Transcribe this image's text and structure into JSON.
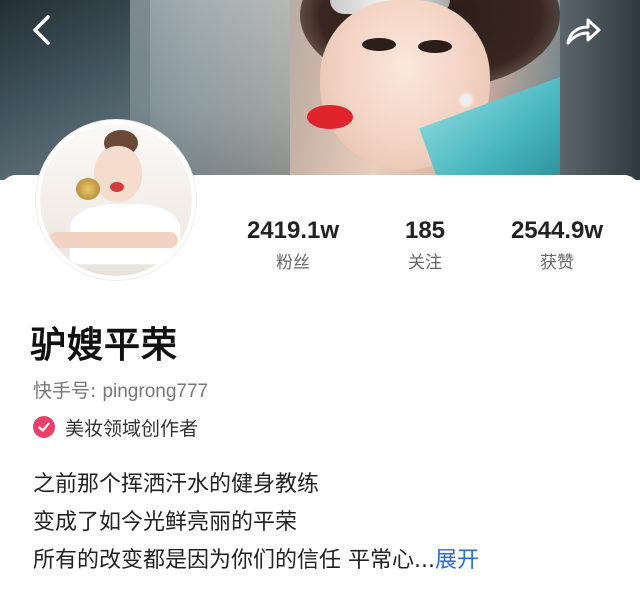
{
  "header": {
    "back_icon": "chevron-left-icon",
    "share_icon": "share-arrow-icon"
  },
  "profile": {
    "name": "驴嫂平荣",
    "kwai_id_label": "快手号: ",
    "kwai_id": "pingrong777",
    "certification": "美妆领域创作者",
    "certification_color": "#e8416b"
  },
  "stats": {
    "fans_value": "2419.1w",
    "fans_label": "粉丝",
    "following_value": "185",
    "following_label": "关注",
    "likes_value": "2544.9w",
    "likes_label": "获赞"
  },
  "bio": {
    "line1": "之前那个挥洒汗水的健身教练",
    "line2": "变成了如今光鲜亮丽的平荣",
    "line3": "所有的改变都是因为你们的信任 平常心...",
    "expand": "展开",
    "expand_color": "#2a6fd6"
  }
}
